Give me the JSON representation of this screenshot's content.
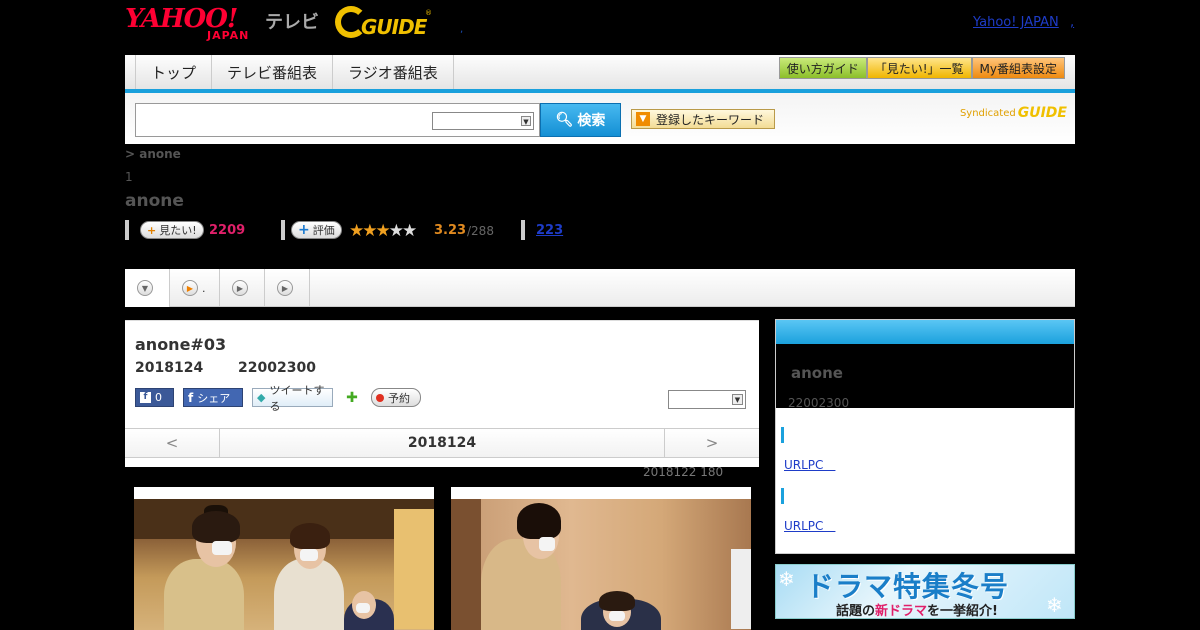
{
  "header": {
    "yahoo_logo": "YAHOO!",
    "yahoo_sub": "JAPAN",
    "tv_label": "テレビ",
    "gguide_logo": "GUIDE",
    "gguide_mark": "®",
    "dot": ",",
    "yahoo_japan_link": "Yahoo! JAPAN",
    "help_link": ","
  },
  "nav": {
    "tabs": [
      "トップ",
      "テレビ番組表",
      "ラジオ番組表"
    ],
    "buttons": [
      "使い方ガイド",
      "「見たい!」一覧",
      "My番組表設定"
    ]
  },
  "search": {
    "placeholder": "",
    "search_button": "検索",
    "keyword_button": "登録したキーワード",
    "syndicated": "Syndicated",
    "gguide": "GUIDE"
  },
  "breadcrumb": "> anone",
  "crumb_num": "1",
  "program_title": "anone",
  "stats": {
    "want_label": "見たい!",
    "want_count": "2209",
    "rate_label": "評価",
    "rating": "3.23",
    "rating_count": "/288",
    "review_count": "223",
    "stars_on": "★★★",
    "stars_off": "★★"
  },
  "subtabs": [
    {
      "icon": "▼",
      "label": ""
    },
    {
      "icon": "▶",
      "label": "."
    },
    {
      "icon": "▶",
      "label": ""
    },
    {
      "icon": "▶",
      "label": ""
    }
  ],
  "episode": {
    "title": "anone#03",
    "date": "2018124",
    "time": "22002300",
    "like_count": "0",
    "share_label": "シェア",
    "tweet_label": "ツイートする",
    "reserve_label": "予約",
    "prev": "<",
    "current": "2018124",
    "next": ">"
  },
  "update_note": "2018122  180",
  "sidebar": {
    "title": "anone",
    "time": "22002300",
    "link1": "URLPC　",
    "link2": "URLPC　"
  },
  "banner": {
    "title": "ドラマ特集冬号",
    "sub_pre": "話題の",
    "sub_em": "新ドラマ",
    "sub_post": "を一挙紹介!"
  }
}
